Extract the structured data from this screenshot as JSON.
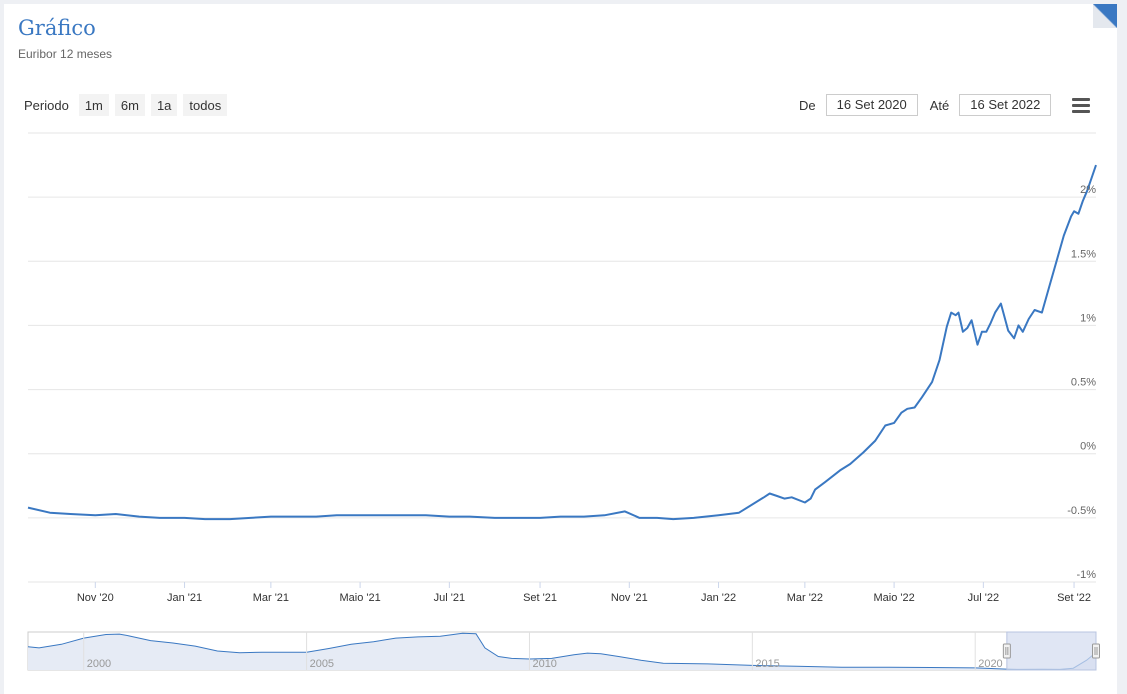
{
  "header": {
    "title": "Gráfico",
    "subtitle": "Euribor 12 meses"
  },
  "range_selector": {
    "label": "Periodo",
    "buttons": [
      "1m",
      "6m",
      "1a",
      "todos"
    ]
  },
  "date_inputs": {
    "from_label": "De",
    "from_value": "16 Set 2020",
    "to_label": "Até",
    "to_value": "16 Set 2022"
  },
  "icons": {
    "menu": "hamburger-menu-icon",
    "corner": "corner-fold-icon"
  },
  "colors": {
    "series": "#3a78c2",
    "navigator_fill": "#e6ebf5",
    "navigator_mask": "#d3dbef",
    "grid": "#e6e6e6",
    "title": "#3a78c2"
  },
  "chart_data": {
    "type": "line",
    "title": "",
    "xlabel": "",
    "ylabel": "",
    "grid": true,
    "ylim": [
      -1,
      2.5
    ],
    "y_ticks": [
      -1,
      -0.5,
      0,
      0.5,
      1,
      1.5,
      2
    ],
    "y_tick_labels": [
      "-1%",
      "-0.5%",
      "0%",
      "0.5%",
      "1%",
      "1.5%",
      "2%"
    ],
    "x_range": [
      "2020-09-16",
      "2022-09-16"
    ],
    "x_ticks": [
      "2020-11-01",
      "2021-01-01",
      "2021-03-01",
      "2021-05-01",
      "2021-07-01",
      "2021-09-01",
      "2021-11-01",
      "2022-01-01",
      "2022-03-01",
      "2022-05-01",
      "2022-07-01",
      "2022-09-01"
    ],
    "x_tick_labels": [
      "Nov '20",
      "Jan '21",
      "Mar '21",
      "Maio '21",
      "Jul '21",
      "Set '21",
      "Nov '21",
      "Jan '22",
      "Mar '22",
      "Maio '22",
      "Jul '22",
      "Set '22"
    ],
    "series": [
      {
        "x": [
          "2020-09-16",
          "2020-10-01",
          "2020-10-15",
          "2020-11-01",
          "2020-11-15",
          "2020-12-01",
          "2020-12-15",
          "2021-01-01",
          "2021-01-15",
          "2021-02-01",
          "2021-02-15",
          "2021-03-01",
          "2021-03-15",
          "2021-04-01",
          "2021-04-15",
          "2021-05-01",
          "2021-05-15",
          "2021-06-01",
          "2021-06-15",
          "2021-07-01",
          "2021-07-15",
          "2021-08-01",
          "2021-08-15",
          "2021-09-01",
          "2021-09-15",
          "2021-10-01",
          "2021-10-15",
          "2021-10-29",
          "2021-11-08",
          "2021-11-20",
          "2021-12-01",
          "2021-12-15",
          "2022-01-01",
          "2022-01-15",
          "2022-02-01",
          "2022-02-05",
          "2022-02-10",
          "2022-02-15",
          "2022-02-20",
          "2022-03-01",
          "2022-03-05",
          "2022-03-08",
          "2022-03-15",
          "2022-03-25",
          "2022-04-01",
          "2022-04-10",
          "2022-04-18",
          "2022-04-25",
          "2022-05-01",
          "2022-05-06",
          "2022-05-10",
          "2022-05-15",
          "2022-05-20",
          "2022-05-27",
          "2022-06-01",
          "2022-06-06",
          "2022-06-09",
          "2022-06-12",
          "2022-06-14",
          "2022-06-17",
          "2022-06-20",
          "2022-06-23",
          "2022-06-27",
          "2022-06-30",
          "2022-07-03",
          "2022-07-06",
          "2022-07-09",
          "2022-07-13",
          "2022-07-18",
          "2022-07-22",
          "2022-07-25",
          "2022-07-28",
          "2022-08-01",
          "2022-08-05",
          "2022-08-10",
          "2022-08-15",
          "2022-08-20",
          "2022-08-25",
          "2022-08-30",
          "2022-09-01",
          "2022-09-04",
          "2022-09-07",
          "2022-09-10",
          "2022-09-13",
          "2022-09-16"
        ],
        "y": [
          -0.42,
          -0.46,
          -0.47,
          -0.48,
          -0.47,
          -0.49,
          -0.5,
          -0.5,
          -0.51,
          -0.51,
          -0.5,
          -0.49,
          -0.49,
          -0.49,
          -0.48,
          -0.48,
          -0.48,
          -0.48,
          -0.48,
          -0.49,
          -0.49,
          -0.5,
          -0.5,
          -0.5,
          -0.49,
          -0.49,
          -0.48,
          -0.45,
          -0.5,
          -0.5,
          -0.51,
          -0.5,
          -0.48,
          -0.46,
          -0.34,
          -0.31,
          -0.33,
          -0.35,
          -0.34,
          -0.38,
          -0.35,
          -0.28,
          -0.22,
          -0.13,
          -0.08,
          0.01,
          0.1,
          0.22,
          0.24,
          0.32,
          0.35,
          0.36,
          0.44,
          0.56,
          0.73,
          0.99,
          1.1,
          1.08,
          1.1,
          0.95,
          0.98,
          1.04,
          0.85,
          0.95,
          0.95,
          1.02,
          1.1,
          1.17,
          0.96,
          0.9,
          1.0,
          0.95,
          1.05,
          1.12,
          1.1,
          1.3,
          1.5,
          1.7,
          1.85,
          1.89,
          1.87,
          1.97,
          2.05,
          2.15,
          2.25
        ]
      }
    ],
    "navigator": {
      "x_tick_labels": [
        "2000",
        "2005",
        "2010",
        "2015",
        "2020"
      ],
      "x_ticks": [
        2000,
        2005,
        2010,
        2015,
        2020
      ],
      "x_range": [
        1998.75,
        2022.71
      ],
      "selected_range": [
        2020.71,
        2022.71
      ],
      "ylim": [
        -0.6,
        5.6
      ],
      "x": [
        1998.75,
        1999.0,
        1999.5,
        2000.0,
        2000.5,
        2000.8,
        2001.0,
        2001.5,
        2002.0,
        2002.5,
        2003.0,
        2003.5,
        2004.0,
        2004.5,
        2005.0,
        2005.5,
        2006.0,
        2006.5,
        2007.0,
        2007.5,
        2008.0,
        2008.5,
        2008.8,
        2009.0,
        2009.3,
        2009.6,
        2010.0,
        2010.5,
        2011.0,
        2011.3,
        2011.6,
        2012.0,
        2012.5,
        2013.0,
        2014.0,
        2015.0,
        2016.0,
        2017.0,
        2018.0,
        2019.0,
        2020.0,
        2020.7,
        2021.0,
        2021.5,
        2021.9,
        2022.2,
        2022.5,
        2022.71
      ],
      "y": [
        3.2,
        3.0,
        3.6,
        4.6,
        5.2,
        5.25,
        5.0,
        4.2,
        3.8,
        3.3,
        2.5,
        2.2,
        2.3,
        2.3,
        2.3,
        2.9,
        3.6,
        4.0,
        4.6,
        4.8,
        4.9,
        5.4,
        5.3,
        3.0,
        1.6,
        1.3,
        1.2,
        1.3,
        1.9,
        2.15,
        2.05,
        1.6,
        1.0,
        0.5,
        0.4,
        0.15,
        0.0,
        -0.15,
        -0.15,
        -0.2,
        -0.25,
        -0.45,
        -0.5,
        -0.49,
        -0.5,
        -0.3,
        1.0,
        2.25
      ]
    }
  }
}
